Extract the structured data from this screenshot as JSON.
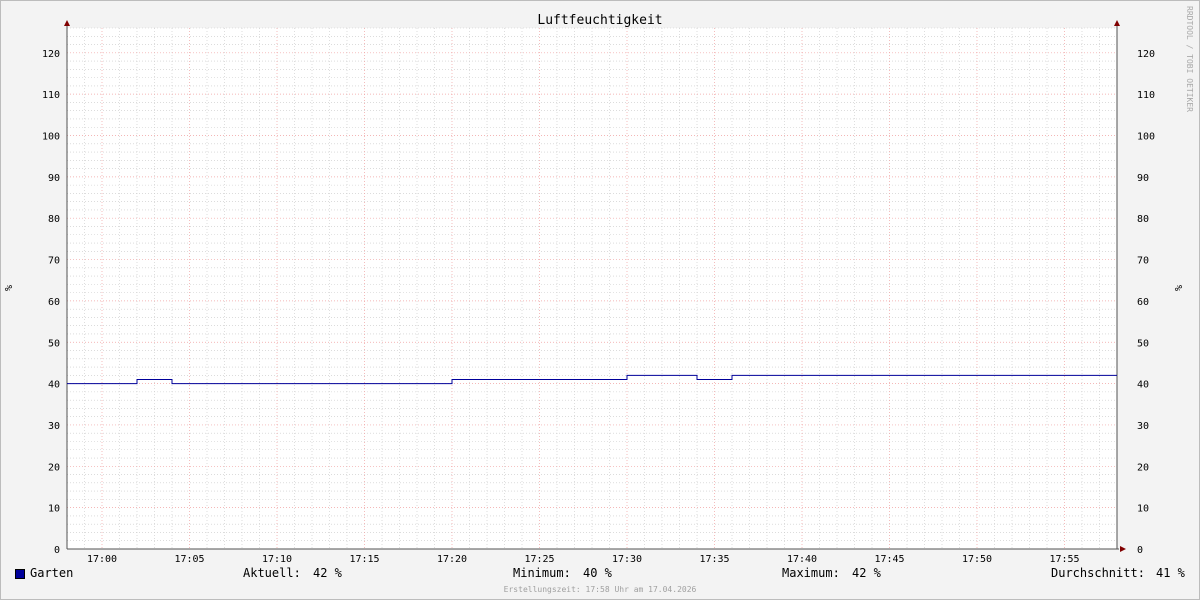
{
  "chart_data": {
    "type": "line",
    "title": "Luftfeuchtigkeit",
    "ylabel": "%",
    "ylabel_right": "%",
    "ylim": [
      0,
      126
    ],
    "yticks": [
      0,
      10,
      20,
      30,
      40,
      50,
      60,
      70,
      80,
      90,
      100,
      110,
      120
    ],
    "x_range": [
      "16:58",
      "17:58"
    ],
    "xticks": [
      "17:00",
      "17:05",
      "17:10",
      "17:15",
      "17:20",
      "17:25",
      "17:30",
      "17:35",
      "17:40",
      "17:45",
      "17:50",
      "17:55"
    ],
    "grid": true,
    "series": [
      {
        "name": "Garten",
        "color": "#00009a",
        "points": [
          [
            "16:58",
            40
          ],
          [
            "17:02",
            40
          ],
          [
            "17:02",
            41
          ],
          [
            "17:04",
            41
          ],
          [
            "17:04",
            40
          ],
          [
            "17:20",
            40
          ],
          [
            "17:20",
            41
          ],
          [
            "17:30",
            41
          ],
          [
            "17:30",
            42
          ],
          [
            "17:34",
            42
          ],
          [
            "17:34",
            41
          ],
          [
            "17:36",
            41
          ],
          [
            "17:36",
            42
          ],
          [
            "17:58",
            42
          ]
        ]
      }
    ]
  },
  "legend": {
    "series_name": "Garten",
    "current_label": "Aktuell:",
    "current_value": "42 %",
    "min_label": "Minimum:",
    "min_value": "40 %",
    "max_label": "Maximum:",
    "max_value": "42 %",
    "avg_label": "Durchschnitt:",
    "avg_value": "41 %"
  },
  "watermark": "RRDTOOL / TOBI OETIKER",
  "footer": "Erstellungszeit: 17:58 Uhr am 17.04.2026",
  "colors": {
    "background": "#f3f3f3",
    "plot_background": "#ffffff",
    "major_grid": "#f0a0a0",
    "minor_grid": "#c8c8c8",
    "series": "#00009a",
    "axis": "#505050",
    "arrow": "#800000"
  }
}
